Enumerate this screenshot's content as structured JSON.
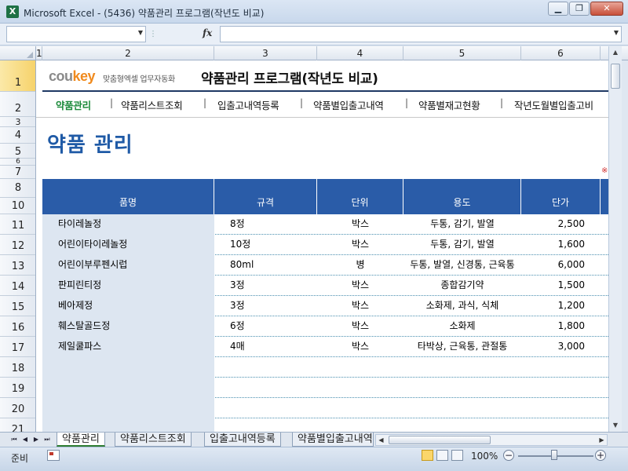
{
  "window": {
    "app_icon": "X",
    "title": "Microsoft Excel - (5436) 약품관리 프로그램(작년도 비교)",
    "minimize_icon": "minimize-icon",
    "restore_icon": "restore-icon",
    "close_icon": "close-icon"
  },
  "formula_bar": {
    "name_box": "",
    "fx_label": "fx",
    "formula": ""
  },
  "columns": [
    "1",
    "2",
    "3",
    "4",
    "5",
    "6"
  ],
  "rows": [
    "1",
    "2",
    "3",
    "4",
    "5",
    "6",
    "7",
    "8",
    "10",
    "11",
    "12",
    "13",
    "14",
    "15",
    "16",
    "17",
    "18",
    "19",
    "20",
    "21"
  ],
  "sheet": {
    "logo_main": "cou",
    "logo_accent": "key",
    "logo_sub": "맞춤형엑셀 업무자동화",
    "title": "약품관리 프로그램(작년도 비교)",
    "nav": [
      {
        "label": "약품관리",
        "active": true
      },
      {
        "label": "약품리스트조회",
        "active": false
      },
      {
        "label": "입출고내역등록",
        "active": false
      },
      {
        "label": "약품별입출고내역",
        "active": false
      },
      {
        "label": "약품별재고현황",
        "active": false
      },
      {
        "label": "작년도월별입출고비",
        "active": false
      }
    ],
    "nav_separator": "|",
    "section_title": "약품 관리",
    "note_mark": "※"
  },
  "table": {
    "headers": [
      "품명",
      "규격",
      "단위",
      "용도",
      "단가"
    ],
    "rows": [
      [
        "타이레놀정",
        "8정",
        "박스",
        "두통, 감기, 발열",
        "2,500"
      ],
      [
        "어린이타이레놀정",
        "10정",
        "박스",
        "두통, 감기, 발열",
        "1,600"
      ],
      [
        "어린이부루펜시럽",
        "80ml",
        "병",
        "두통, 발열, 신경통, 근육통",
        "6,000"
      ],
      [
        "판피린티정",
        "3정",
        "박스",
        "종합감기약",
        "1,500"
      ],
      [
        "베아제정",
        "3정",
        "박스",
        "소화제, 과식, 식체",
        "1,200"
      ],
      [
        "훼스탈골드정",
        "6정",
        "박스",
        "소화제",
        "1,800"
      ],
      [
        "제일쿨파스",
        "4매",
        "박스",
        "타박상, 근육통, 관절통",
        "3,000"
      ],
      [
        "",
        "",
        "",
        "",
        ""
      ],
      [
        "",
        "",
        "",
        "",
        ""
      ],
      [
        "",
        "",
        "",
        "",
        ""
      ]
    ]
  },
  "sheet_tabs": [
    "약품관리",
    "약품리스트조회",
    "입출고내역등록",
    "약품별입출고내역"
  ],
  "status": {
    "ready": "준비",
    "zoom": "100%",
    "zoom_minus": "−",
    "zoom_plus": "+"
  }
}
